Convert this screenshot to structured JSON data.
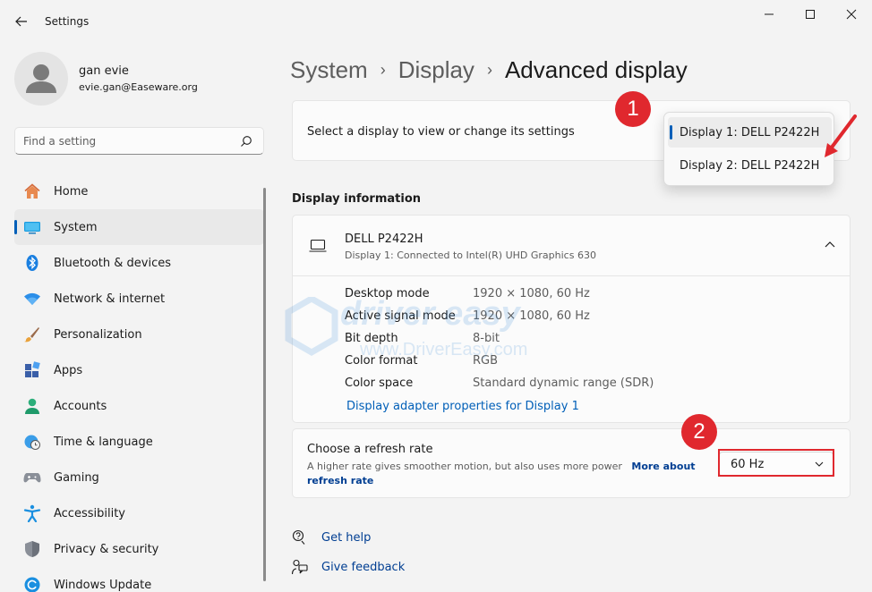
{
  "window": {
    "title": "Settings"
  },
  "profile": {
    "name": "gan evie",
    "email": "evie.gan@Easeware.org"
  },
  "search": {
    "placeholder": "Find a setting"
  },
  "nav": {
    "items": [
      {
        "label": "Home",
        "icon": "home-icon"
      },
      {
        "label": "System",
        "icon": "system-icon",
        "active": true
      },
      {
        "label": "Bluetooth & devices",
        "icon": "bluetooth-icon"
      },
      {
        "label": "Network & internet",
        "icon": "wifi-icon"
      },
      {
        "label": "Personalization",
        "icon": "brush-icon"
      },
      {
        "label": "Apps",
        "icon": "apps-icon"
      },
      {
        "label": "Accounts",
        "icon": "person-icon"
      },
      {
        "label": "Time & language",
        "icon": "globe-clock-icon"
      },
      {
        "label": "Gaming",
        "icon": "gamepad-icon"
      },
      {
        "label": "Accessibility",
        "icon": "accessibility-icon"
      },
      {
        "label": "Privacy & security",
        "icon": "shield-icon"
      },
      {
        "label": "Windows Update",
        "icon": "update-icon"
      }
    ]
  },
  "breadcrumb": {
    "items": [
      "System",
      "Display"
    ],
    "current": "Advanced display"
  },
  "display_select": {
    "label": "Select a display to view or change its settings",
    "options": [
      "Display 1: DELL P2422H",
      "Display 2: DELL P2422H"
    ],
    "selected_index": 0
  },
  "display_info": {
    "section_title": "Display information",
    "name": "DELL P2422H",
    "subtitle": "Display 1: Connected to Intel(R) UHD Graphics 630",
    "rows": [
      {
        "key": "Desktop mode",
        "value": "1920 × 1080, 60 Hz"
      },
      {
        "key": "Active signal mode",
        "value": "1920 × 1080, 60 Hz"
      },
      {
        "key": "Bit depth",
        "value": "8-bit"
      },
      {
        "key": "Color format",
        "value": "RGB"
      },
      {
        "key": "Color space",
        "value": "Standard dynamic range (SDR)"
      }
    ],
    "adapter_link": "Display adapter properties for Display 1"
  },
  "refresh": {
    "title": "Choose a refresh rate",
    "description": "A higher rate gives smoother motion, but also uses more power",
    "more_link": "More about refresh rate",
    "value": "60 Hz"
  },
  "watermark": {
    "text": "driver easy",
    "url": "www.DriverEasy.com"
  },
  "annotations": {
    "badge1": "1",
    "badge2": "2",
    "color": "#e0282e"
  },
  "help": {
    "get_help": "Get help",
    "feedback": "Give feedback"
  },
  "colors": {
    "accent": "#005fb8",
    "link": "#003e92",
    "annotation": "#e0282e"
  }
}
